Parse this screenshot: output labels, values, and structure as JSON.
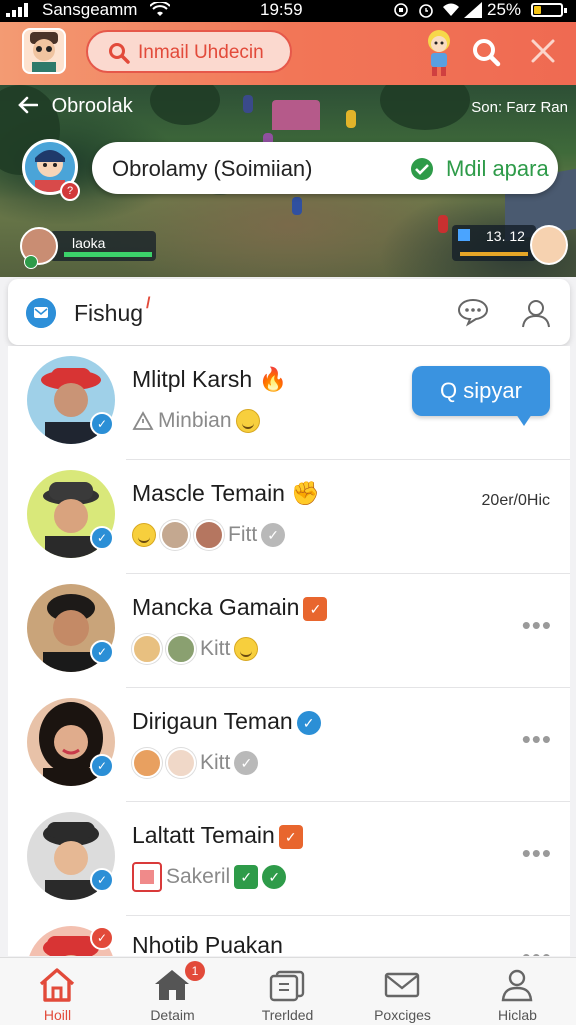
{
  "status_bar": {
    "carrier": "Sansgeamm",
    "time": "19:59",
    "battery": "25%",
    "battery_level": 0.25
  },
  "header": {
    "search_text": "Inmail Uhdecin"
  },
  "banner": {
    "back_label": "Obroolak",
    "right_info": "Son: Farz Ran",
    "topic_title": "Obrolamy (Soimiian)",
    "topic_status": "Mdil apara",
    "left_player": "laoka",
    "score": "13. 12",
    "profile_badge": "?"
  },
  "section": {
    "title": "Fishug"
  },
  "contacts": [
    {
      "name": "Mlitpl Karsh",
      "sub": "Minbian",
      "action": "Q sipyar",
      "avatar_color": "#9fd0e8"
    },
    {
      "name": "Mascle Temain",
      "sub": "Fitt",
      "time": "20er/0Hic",
      "avatar_color": "#d9e87a"
    },
    {
      "name": "Mancka Gamain",
      "sub": "Kitt",
      "avatar_color": "#c9a47a"
    },
    {
      "name": "Dirigaun Teman",
      "sub": "Kitt",
      "avatar_color": "#e8c2a8"
    },
    {
      "name": "Laltatt Temain",
      "sub": "Sakeril",
      "avatar_color": "#dcdcdc"
    },
    {
      "name": "Nhotib Puakan",
      "sub": "",
      "avatar_color": "#f3c0b0"
    }
  ],
  "bottom_nav": [
    {
      "label": "Hoill",
      "icon": "home-icon",
      "active": true
    },
    {
      "label": "Detaim",
      "icon": "house-icon",
      "badge": "1"
    },
    {
      "label": "Trerlded",
      "icon": "cards-icon"
    },
    {
      "label": "Poxciges",
      "icon": "mail-icon"
    },
    {
      "label": "Hiclab",
      "icon": "person-icon"
    }
  ],
  "colors": {
    "accent": "#ef6a52",
    "blue": "#2b8fd6",
    "green": "#2e9b49"
  }
}
